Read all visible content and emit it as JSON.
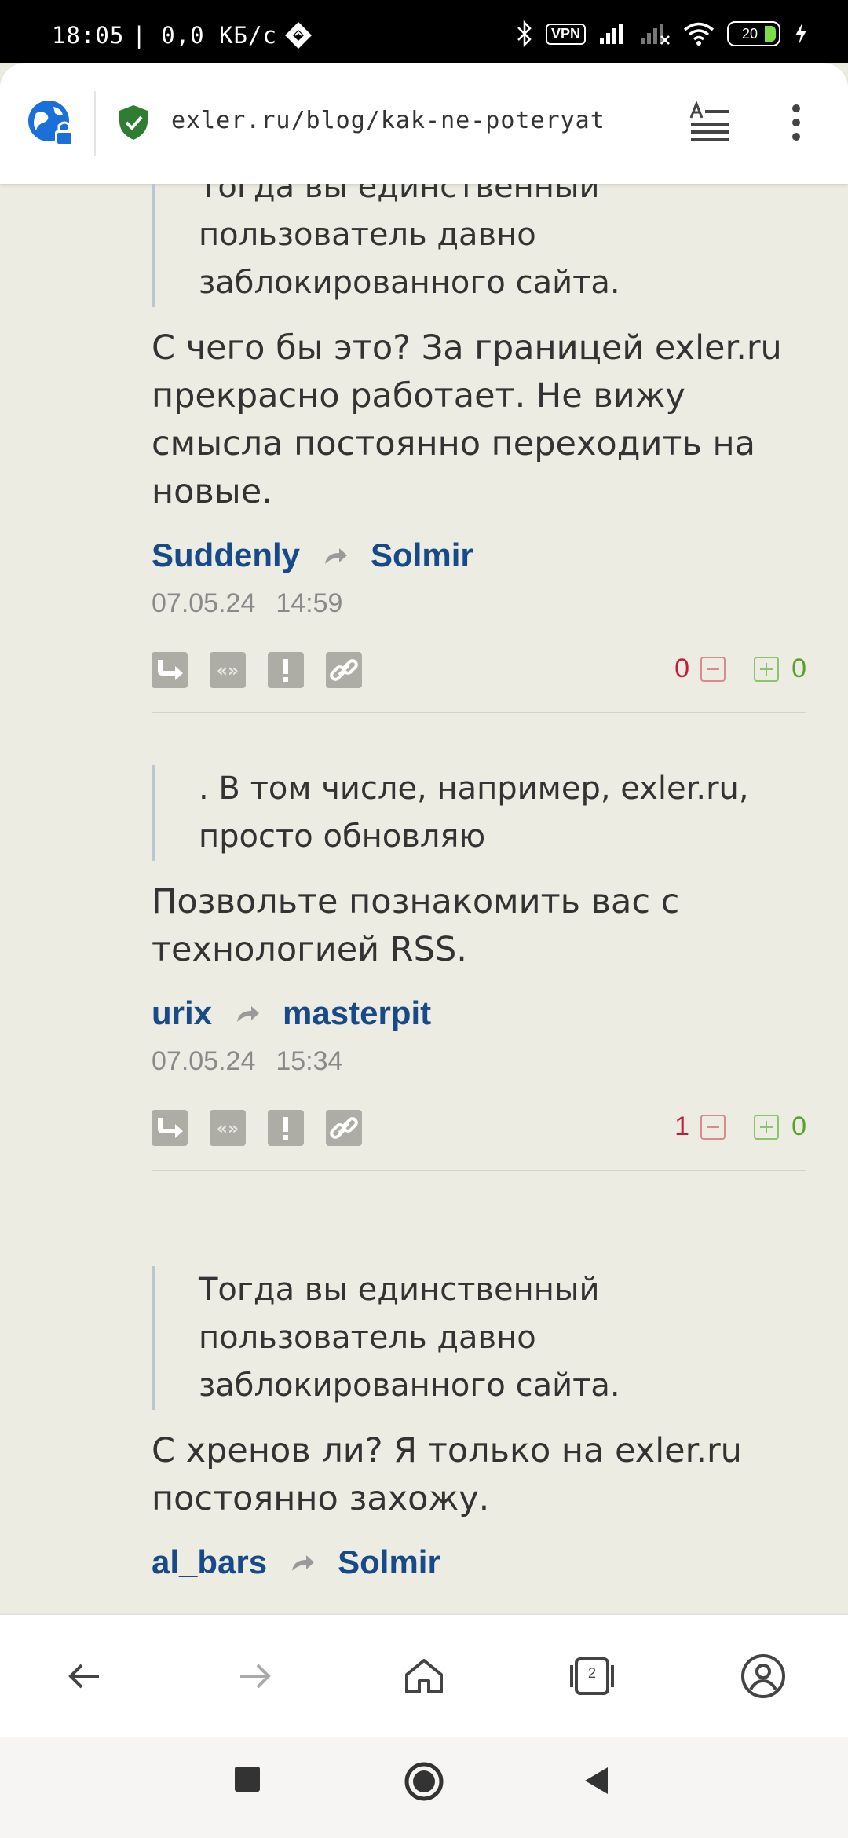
{
  "status_bar": {
    "time": "18:05",
    "speed": "| 0,0 КБ/с",
    "vpn_label": "VPN",
    "battery": "20"
  },
  "browser": {
    "url": "exler.ru/blog/kak-ne-poteryat",
    "tab_count": "2"
  },
  "comments": [
    {
      "quote": "Тогда вы единственный пользователь давно заблокированного сайта.",
      "text": "С чего бы это? За границей exler.ru прекрасно работает. Не вижу смысла постоянно переходить на новые.",
      "author": "Suddenly",
      "reply_to": "Solmir",
      "date": "07.05.24",
      "time": "14:59",
      "votes_minus": "0",
      "votes_plus": "0"
    },
    {
      "quote": ". В том числе, например, exler.ru, просто обновляю",
      "text": "Позвольте познакомить вас с технологией RSS.",
      "author": "urix",
      "reply_to": "masterpit",
      "date": "07.05.24",
      "time": "15:34",
      "votes_minus": "1",
      "votes_plus": "0"
    },
    {
      "quote": "Тогда вы единственный пользователь давно заблокированного сайта.",
      "text": "С хренов ли? Я только на exler.ru постоянно захожу.",
      "author": "al_bars",
      "reply_to": "Solmir"
    }
  ],
  "icons": {
    "reply": "reply-icon",
    "quote": "quote-icon",
    "report": "report-icon",
    "link": "link-icon"
  },
  "colors": {
    "page_bg": "#ecece3",
    "author": "#174a86",
    "vote_negative": "#c51b3a",
    "vote_positive": "#5aa02c"
  }
}
